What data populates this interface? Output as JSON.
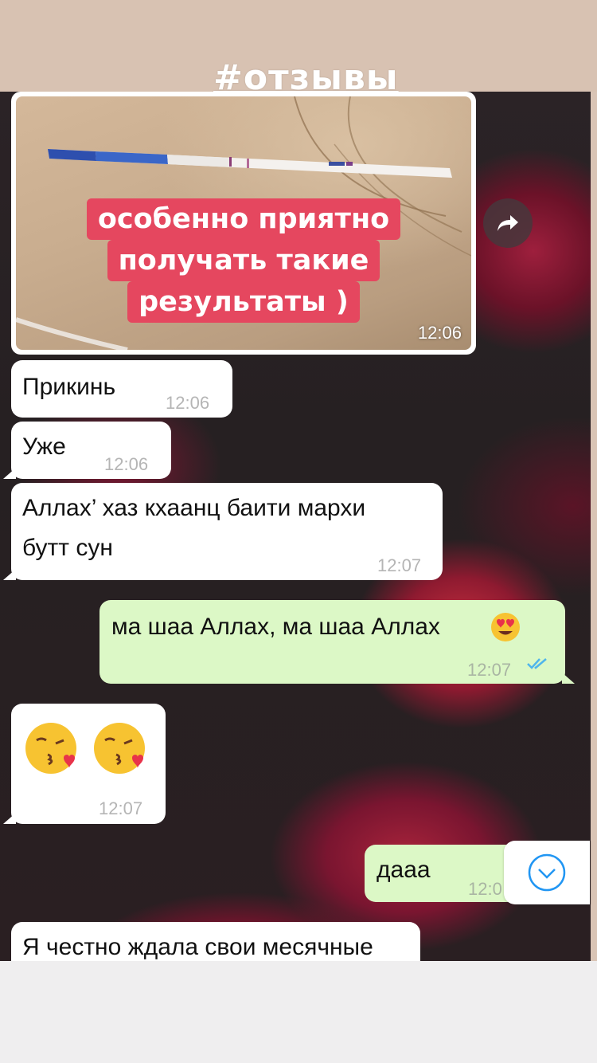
{
  "story": {
    "hashtag": "#отзывы"
  },
  "image_message": {
    "caption_lines": [
      "особенно приятно",
      "получать такие",
      "результаты )"
    ],
    "time": "12:06"
  },
  "messages": [
    {
      "direction": "incoming",
      "text": "Прикинь",
      "time": "12:06"
    },
    {
      "direction": "incoming",
      "text": "Уже",
      "time": "12:06"
    },
    {
      "direction": "incoming",
      "text_line1": "Аллах’ хаз кхаанц баити мархи",
      "text_line2": "бутт сун",
      "time": "12:07"
    },
    {
      "direction": "outgoing",
      "text": "ма шаа Аллах, ма шаа Аллах",
      "time": "12:07",
      "status": "read"
    },
    {
      "direction": "incoming",
      "emoji": [
        "face-blowing-kiss",
        "face-blowing-kiss"
      ],
      "time": "12:07"
    },
    {
      "direction": "outgoing",
      "text": "дааа",
      "time": "12:0"
    },
    {
      "direction": "incoming",
      "text": "Я честно ждала свои месячные"
    }
  ],
  "icons": {
    "forward": "forward-arrow-icon",
    "scroll_down": "chevron-down-circle-icon",
    "read_status": "double-check-icon"
  },
  "colors": {
    "caption_bg": "#e5475f",
    "outgoing_bubble": "#dcf8c6",
    "incoming_bubble": "#ffffff",
    "read_ticks": "#4fb5ec",
    "scroll_icon": "#2196f3"
  }
}
